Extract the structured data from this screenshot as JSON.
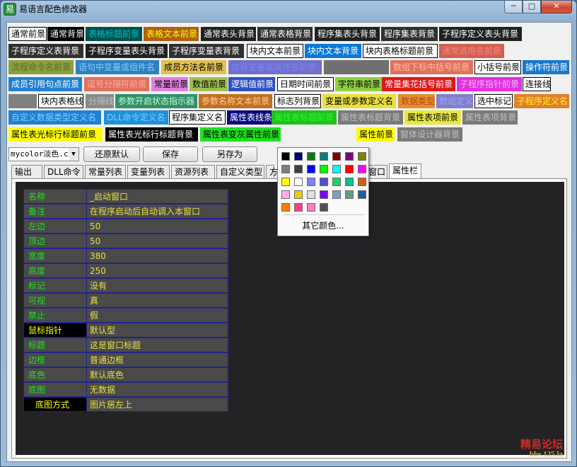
{
  "window": {
    "title": "易语言配色修改器",
    "app_icon": "app-icon",
    "buttons": {
      "minimize": "─",
      "maximize": "□",
      "close": "✕"
    }
  },
  "chips": [
    {
      "id": "c1",
      "label": "通常前景",
      "fg": "#000000",
      "bg": "#ffffff",
      "border": "#000000"
    },
    {
      "id": "c2",
      "label": "通常背景",
      "fg": "#ffffff",
      "bg": "#000000"
    },
    {
      "id": "c3",
      "label": "表格标题前景",
      "fg": "#00c0c0",
      "bg": "#005050"
    },
    {
      "id": "c4",
      "label": "表格文本前景",
      "fg": "#ffff00",
      "bg": "#b06010"
    },
    {
      "id": "c5",
      "label": "通常表头背景",
      "fg": "#ffffff",
      "bg": "#202020"
    },
    {
      "id": "c6",
      "label": "通常表格背景",
      "fg": "#ffffff",
      "bg": "#303030"
    },
    {
      "id": "c7",
      "label": "程序集表头背景",
      "fg": "#ffffff",
      "bg": "#202020"
    },
    {
      "id": "c8",
      "label": "程序集表背景",
      "fg": "#ffffff",
      "bg": "#303030"
    },
    {
      "id": "c9",
      "label": "子程序定义表头背景",
      "fg": "#ffffff",
      "bg": "#202020"
    },
    {
      "id": "c10",
      "label": "子程序定义表背景",
      "fg": "#ffffff",
      "bg": "#303030"
    },
    {
      "id": "c11",
      "label": "子程序变量表头背景",
      "fg": "#ffffff",
      "bg": "#202020"
    },
    {
      "id": "c12",
      "label": "子程序变量表背景",
      "fg": "#ffffff",
      "bg": "#303030"
    },
    {
      "id": "c13",
      "label": "块内文本前景",
      "fg": "#000000",
      "bg": "#ffffff",
      "border": "#000000"
    },
    {
      "id": "c14",
      "label": "块内文本背景",
      "fg": "#ffffff",
      "bg": "#0a78d8"
    },
    {
      "id": "c15",
      "label": "块内表格标题前景",
      "fg": "#000000",
      "bg": "#ffffff",
      "border": "#000000"
    },
    {
      "id": "c16",
      "label": "通常调用名前景",
      "fg": "#ff8080",
      "bg": "#d06050"
    },
    {
      "id": "c17",
      "label": "流程命令名前景",
      "fg": "#5c6b2a",
      "bg": "#8aa040"
    },
    {
      "id": "c18",
      "label": "语句中变量或组件名",
      "fg": "#80d0ff",
      "bg": "#3080c0"
    },
    {
      "id": "c19",
      "label": "成员方法名前景",
      "fg": "#000000",
      "bg": "#e0c050"
    },
    {
      "id": "c20",
      "label": "成员变量或属性名前景",
      "fg": "#8080ff",
      "bg": "#7070c8"
    },
    {
      "id": "c21",
      "label": "",
      "fg": "#ffffff",
      "bg": "#707070"
    },
    {
      "id": "c22",
      "label": "数组下标中括号前景",
      "fg": "#ffc0a0",
      "bg": "#e07060"
    },
    {
      "id": "c23",
      "label": "小括号前景",
      "fg": "#000000",
      "bg": "#ffffff",
      "border": "#000000"
    },
    {
      "id": "c24",
      "label": "操作符前景",
      "fg": "#ffffff",
      "bg": "#1878d0"
    },
    {
      "id": "c25",
      "label": "成员引用句点前景",
      "fg": "#ffffff",
      "bg": "#2080d0"
    },
    {
      "id": "c26",
      "label": "逗号分隔符前景",
      "fg": "#ffb0a0",
      "bg": "#e07060"
    },
    {
      "id": "c27",
      "label": "常量前景",
      "fg": "#000000",
      "bg": "#e080e0"
    },
    {
      "id": "c28",
      "label": "数值前景",
      "fg": "#000000",
      "bg": "#a0c050"
    },
    {
      "id": "c29",
      "label": "逻辑值前景",
      "fg": "#ffffff",
      "bg": "#3050c0"
    },
    {
      "id": "c30",
      "label": "日期时间前景",
      "fg": "#000000",
      "bg": "#ffffff",
      "border": "#000000"
    },
    {
      "id": "c31",
      "label": "字符串前景",
      "fg": "#000000",
      "bg": "#90d040"
    },
    {
      "id": "c32",
      "label": "常量集花括号前景",
      "fg": "#ffffff",
      "bg": "#e01818"
    },
    {
      "id": "c33",
      "label": "子程序指针前景",
      "fg": "#ffb0ff",
      "bg": "#e030e0"
    },
    {
      "id": "c34",
      "label": "连接线",
      "fg": "#000000",
      "bg": "#ffffff",
      "border": "#000000"
    },
    {
      "id": "c35",
      "label": "",
      "fg": "#ffffff",
      "bg": "#808080"
    },
    {
      "id": "c36",
      "label": "块内表格线",
      "fg": "#000000",
      "bg": "#ffffff",
      "border": "#000000"
    },
    {
      "id": "c37",
      "label": "分隔线",
      "fg": "#c0c0c0",
      "bg": "#8a8a8a"
    },
    {
      "id": "c38",
      "label": "参数开启状态指示器",
      "fg": "#c0ffc0",
      "bg": "#309070"
    },
    {
      "id": "c39",
      "label": "参数名称文本前景",
      "fg": "#ffd0a0",
      "bg": "#c07020"
    },
    {
      "id": "c40",
      "label": "标志列背景",
      "fg": "#000000",
      "bg": "#ffffff",
      "border": "#000000"
    },
    {
      "id": "c41",
      "label": "变量或参数定义名",
      "fg": "#000000",
      "bg": "#e8e040"
    },
    {
      "id": "c42",
      "label": "数据类型",
      "fg": "#c04010",
      "bg": "#e09030"
    },
    {
      "id": "c43",
      "label": "数组定义",
      "fg": "#a0a0ff",
      "bg": "#8080c8"
    },
    {
      "id": "c44",
      "label": "选中标记",
      "fg": "#000000",
      "bg": "#ffffff",
      "border": "#000000"
    },
    {
      "id": "c45",
      "label": "子程序定义名",
      "fg": "#ffff00",
      "bg": "#e08030"
    },
    {
      "id": "c46",
      "label": "自定义数据类型定义名",
      "fg": "#80d0ff",
      "bg": "#2080d0"
    },
    {
      "id": "c47",
      "label": "DLL命令定义名",
      "fg": "#80d0ff",
      "bg": "#2090d8"
    },
    {
      "id": "c48",
      "label": "程序集定义名",
      "fg": "#000000",
      "bg": "#ffffff",
      "border": "#000000"
    },
    {
      "id": "c49",
      "label": "属性表线条",
      "fg": "#ffffff",
      "bg": "#0a0a80"
    },
    {
      "id": "c50",
      "label": "属性表标题前景",
      "fg": "#20ff20",
      "bg": "#20c020"
    },
    {
      "id": "c51",
      "label": "属性表标题背景",
      "fg": "#c0c0c0",
      "bg": "#7a7a7a"
    },
    {
      "id": "c52",
      "label": "属性表项前景",
      "fg": "#000000",
      "bg": "#e8e840"
    },
    {
      "id": "c53",
      "label": "属性表项背景",
      "fg": "#c0c0c0",
      "bg": "#7a7a7a"
    },
    {
      "id": "c54",
      "label": "属性表光标行标题前景",
      "fg": "#000000",
      "bg": "#ffff00"
    },
    {
      "id": "c55",
      "label": "属性表光标行标题背景",
      "fg": "#ffffff",
      "bg": "#000000"
    },
    {
      "id": "c56",
      "label": "属性表变灰属性前景",
      "fg": "#000000",
      "bg": "#20e020"
    },
    {
      "id": "c57",
      "label": "属性前景",
      "fg": "#000000",
      "bg": "#ffff00"
    },
    {
      "id": "c58",
      "label": "窗体设计器背景",
      "fg": "#c0c0c0",
      "bg": "#7a7a7a"
    }
  ],
  "toolbar": {
    "scheme_value": "mycolor淡色.c",
    "scheme_arrow": "▼",
    "restore_label": "还原默认",
    "save_label": "保存",
    "save_as_label": "另存为"
  },
  "tabs": [
    {
      "label": "输出"
    },
    {
      "label": "DLL命令"
    },
    {
      "label": "常量列表"
    },
    {
      "label": "变量列表"
    },
    {
      "label": "资源列表"
    },
    {
      "label": "自定义类型"
    },
    {
      "label": "方"
    },
    {
      "label": "计窗口"
    },
    {
      "label": "属性栏"
    }
  ],
  "property_table": {
    "rows": [
      {
        "name": "名称",
        "value": "_启动窗口",
        "type": "normal"
      },
      {
        "name": "备注",
        "value": "在程序启动后自动调入本窗口",
        "type": "normal"
      },
      {
        "name": "左边",
        "value": "50",
        "type": "normal"
      },
      {
        "name": "顶边",
        "value": "50",
        "type": "normal"
      },
      {
        "name": "宽度",
        "value": "380",
        "type": "normal"
      },
      {
        "name": "高度",
        "value": "250",
        "type": "normal"
      },
      {
        "name": "标记",
        "value": "没有",
        "type": "normal"
      },
      {
        "name": "可视",
        "value": "真",
        "type": "normal"
      },
      {
        "name": "禁止",
        "value": "假",
        "type": "normal"
      },
      {
        "name": "鼠标指针",
        "value": "默认型",
        "type": "cursor"
      },
      {
        "name": "标题",
        "value": "这是窗口标题",
        "type": "normal"
      },
      {
        "name": "边框",
        "value": "普通边框",
        "type": "normal"
      },
      {
        "name": "底色",
        "value": "默认底色",
        "type": "normal"
      },
      {
        "name": "底图",
        "value": "无数据",
        "type": "normal"
      },
      {
        "name": "底图方式",
        "value": "图片居左上",
        "type": "cursor"
      }
    ],
    "colors": {
      "name_fg": "#20e020",
      "name_bg": "#4a4a4a",
      "value_fg": "#e8e040",
      "value_bg": "#4a4a4a",
      "cursor_name_fg": "#ffff00",
      "cursor_name_bg": "#000000",
      "line": "#22238a"
    }
  },
  "color_popup": {
    "swatches": [
      "#000000",
      "#000080",
      "#008000",
      "#008080",
      "#800000",
      "#800080",
      "#808000",
      "#808080",
      "#404040",
      "#0000ff",
      "#00ff00",
      "#00ffff",
      "#ff0000",
      "#ff00ff",
      "#ffff00",
      "#ffffff",
      "#8080ff",
      "#5050d0",
      "#20d060",
      "#00c090",
      "#d06010",
      "#ffb0e0",
      "#e8d000",
      "#e0e0e0",
      "#8000ff",
      "#80a0c0",
      "#60a080",
      "#2060a0",
      "#ff8000",
      "#ff4080",
      "#ff80c0",
      "#505050"
    ],
    "more_label": "其它颜色..."
  },
  "watermark": {
    "line1": "精易论坛",
    "line2": "bbs.125.la"
  }
}
